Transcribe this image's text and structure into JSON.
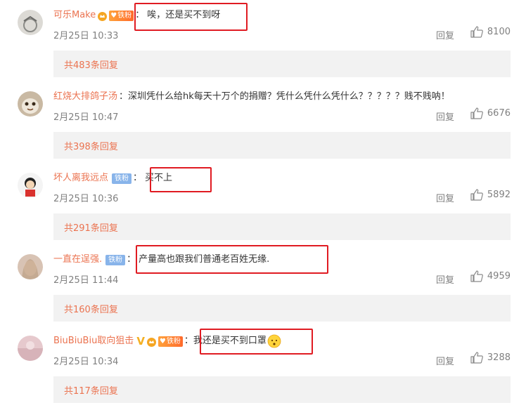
{
  "comments": [
    {
      "username": "可乐Make",
      "badge": "铁粉",
      "text": "唉，还是买不到呀",
      "time": "2月25日 10:33",
      "reply_label": "回复",
      "likes": "8100",
      "replies": "共483条回复"
    },
    {
      "username": "红烧大排鸽子汤",
      "text": "深圳凭什么给hk每天十万个的捐赠？凭什么凭什么凭什么？？？？？贱不贱呐！",
      "time": "2月25日 10:47",
      "reply_label": "回复",
      "likes": "6676",
      "replies": "共398条回复"
    },
    {
      "username": "坏人离我远点",
      "badge": "铁粉",
      "text": "买不上",
      "time": "2月25日 10:36",
      "reply_label": "回复",
      "likes": "5892",
      "replies": "共291条回复"
    },
    {
      "username": "一直在逞强.",
      "badge": "铁粉",
      "text": "产量高也跟我们普通老百姓无缘.",
      "time": "2月25日 11:44",
      "reply_label": "回复",
      "likes": "4959",
      "replies": "共160条回复"
    },
    {
      "username": "BiuBiuBiu取向狙击",
      "badge": "铁粉",
      "verified_mark": "V",
      "text": "我还是买不到口罩",
      "time": "2月25日 10:34",
      "reply_label": "回复",
      "likes": "3288",
      "replies": "共117条回复"
    }
  ],
  "colors": {
    "username": "#eb7350",
    "highlight_box": "#e01b22",
    "meta": "#808080",
    "reply_bg": "#f2f2f2"
  },
  "icons": {
    "like": "thumbs-up-icon",
    "vip": "vip-crown-icon",
    "emoji": "worried-face-emoji-icon"
  }
}
